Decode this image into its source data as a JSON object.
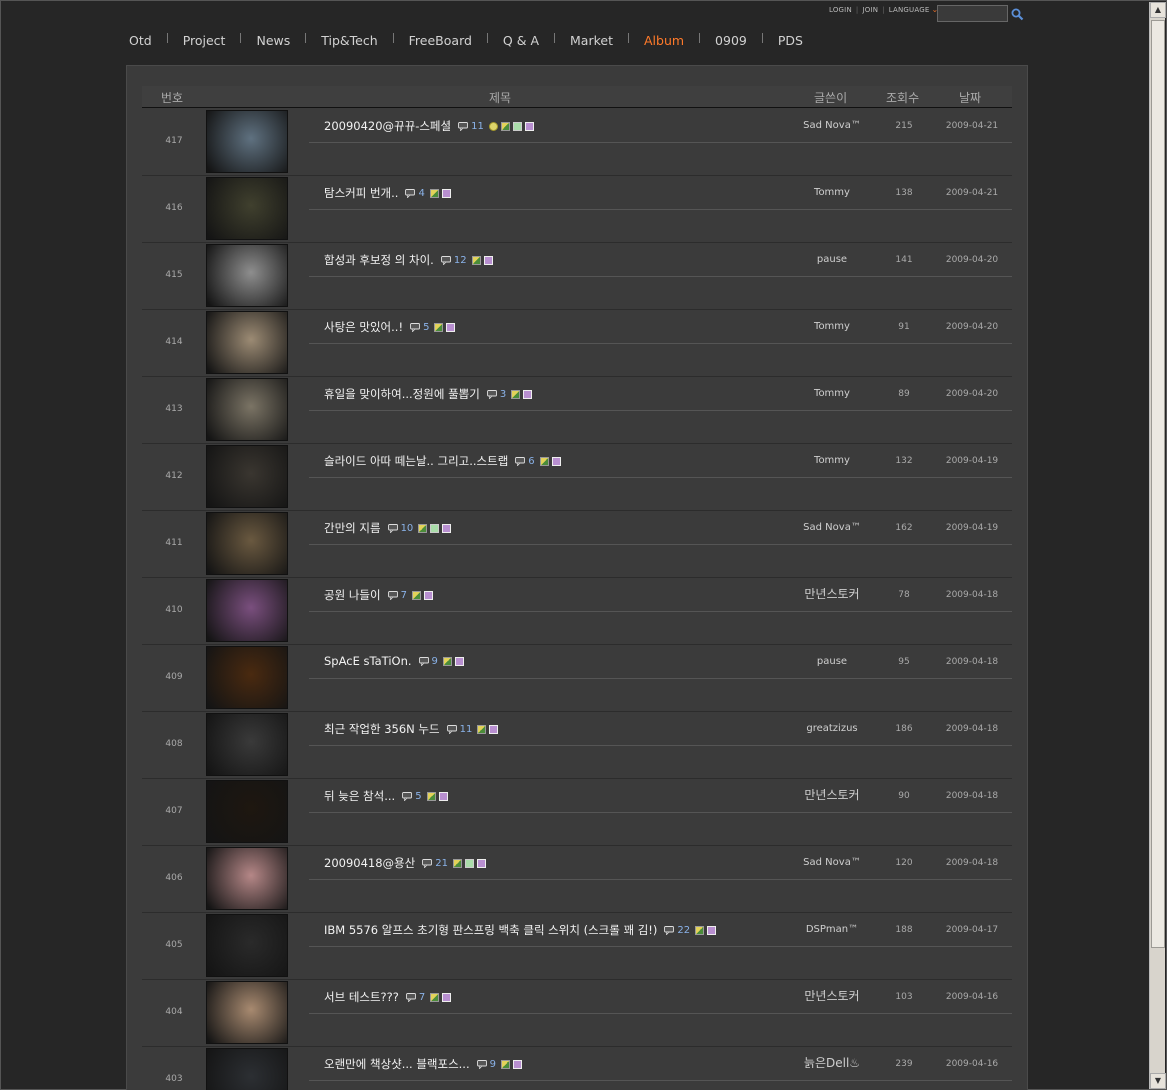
{
  "util": {
    "login": "LOGIN",
    "join": "JOIN",
    "language": "LANGUAGE"
  },
  "search": {
    "placeholder": ""
  },
  "nav": [
    "Otd",
    "Project",
    "News",
    "Tip&Tech",
    "FreeBoard",
    "Q & A",
    "Market",
    "Album",
    "0909",
    "PDS"
  ],
  "nav_active": "Album",
  "colors": {
    "active": "#ff7a2a",
    "comment_count": "#8ab2e8",
    "background": "#262626",
    "panel": "#3b3b3b"
  },
  "table": {
    "headers": {
      "no": "번호",
      "title": "제목",
      "author": "글쓴이",
      "views": "조회수",
      "date": "날짜"
    },
    "rows": [
      {
        "no": "417",
        "title": "20090420@뀨뀨-스페셜",
        "comments": "11",
        "badges": [
          "new",
          "img",
          "mov",
          "disk"
        ],
        "author": "Sad Nova™",
        "views": "215",
        "date": "2009-04-21",
        "thumb": "#5f7180"
      },
      {
        "no": "416",
        "title": "탐스커피 번개..",
        "comments": "4",
        "badges": [
          "img",
          "disk"
        ],
        "author": "Tommy",
        "views": "138",
        "date": "2009-04-21",
        "thumb": "#40402e"
      },
      {
        "no": "415",
        "title": "합성과 후보정 의 차이.",
        "comments": "12",
        "badges": [
          "img",
          "disk"
        ],
        "author": "pause",
        "views": "141",
        "date": "2009-04-20",
        "thumb": "#8e8e8e"
      },
      {
        "no": "414",
        "title": "사탕은 맛있어..!",
        "comments": "5",
        "badges": [
          "img",
          "disk"
        ],
        "author": "Tommy",
        "views": "91",
        "date": "2009-04-20",
        "thumb": "#9c8b74"
      },
      {
        "no": "413",
        "title": "휴일을 맞이하여...정원에 풀뽑기",
        "comments": "3",
        "badges": [
          "img",
          "disk"
        ],
        "author": "Tommy",
        "views": "89",
        "date": "2009-04-20",
        "thumb": "#7b7465"
      },
      {
        "no": "412",
        "title": "슬라이드 아따 떼는날.. 그리고..스트랩",
        "comments": "6",
        "badges": [
          "img",
          "disk"
        ],
        "author": "Tommy",
        "views": "132",
        "date": "2009-04-19",
        "thumb": "#3a3630"
      },
      {
        "no": "411",
        "title": "간만의 지름",
        "comments": "10",
        "badges": [
          "img",
          "mov",
          "disk"
        ],
        "author": "Sad Nova™",
        "views": "162",
        "date": "2009-04-19",
        "thumb": "#6a5940"
      },
      {
        "no": "410",
        "title": "공원 나들이",
        "comments": "7",
        "badges": [
          "img",
          "disk"
        ],
        "author": "만년스토커",
        "views": "78",
        "date": "2009-04-18",
        "thumb": "#7a4f7e"
      },
      {
        "no": "409",
        "title": "SpAcE sTaTiOn.",
        "comments": "9",
        "badges": [
          "img",
          "disk"
        ],
        "author": "pause",
        "views": "95",
        "date": "2009-04-18",
        "thumb": "#4a2a10"
      },
      {
        "no": "408",
        "title": "최근 작업한 356N 누드",
        "comments": "11",
        "badges": [
          "img",
          "disk"
        ],
        "author": "greatzizus",
        "views": "186",
        "date": "2009-04-18",
        "thumb": "#3a3a3a"
      },
      {
        "no": "407",
        "title": "뒤 늦은 참석...",
        "comments": "5",
        "badges": [
          "img",
          "disk"
        ],
        "author": "만년스토커",
        "views": "90",
        "date": "2009-04-18",
        "thumb": "#1e1710"
      },
      {
        "no": "406",
        "title": "20090418@용산",
        "comments": "21",
        "badges": [
          "img",
          "mov",
          "disk"
        ],
        "author": "Sad Nova™",
        "views": "120",
        "date": "2009-04-18",
        "thumb": "#b58787"
      },
      {
        "no": "405",
        "title": "IBM 5576 알프스 초기형 판스프링 백축 클릭 스위치 (스크롤 꽤 김!)",
        "comments": "22",
        "badges": [
          "img",
          "disk"
        ],
        "author": "DSPman™",
        "views": "188",
        "date": "2009-04-17",
        "thumb": "#2a2a2a"
      },
      {
        "no": "404",
        "title": "서브 테스트???",
        "comments": "7",
        "badges": [
          "img",
          "disk"
        ],
        "author": "만년스토커",
        "views": "103",
        "date": "2009-04-16",
        "thumb": "#a88a70"
      },
      {
        "no": "403",
        "title": "오랜만에 책상샷... 블랙포스...",
        "comments": "9",
        "badges": [
          "img",
          "disk"
        ],
        "author": "늙은Dell♨",
        "views": "239",
        "date": "2009-04-16",
        "thumb": "#2c2f33"
      }
    ]
  }
}
